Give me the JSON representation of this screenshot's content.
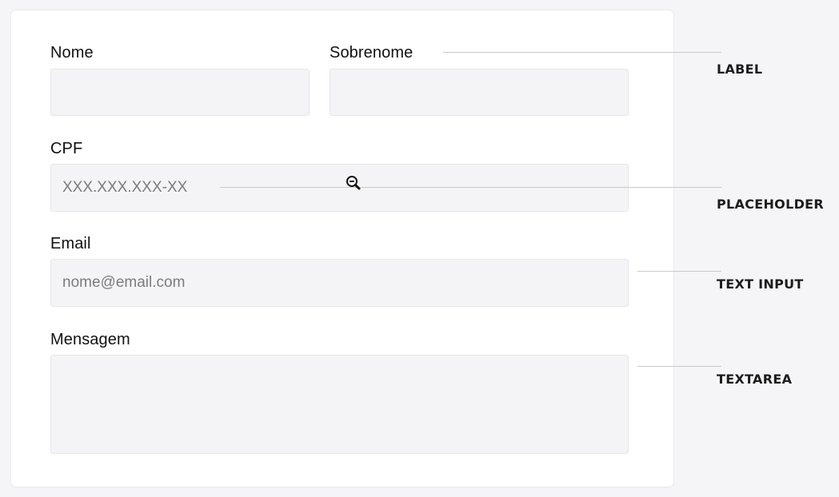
{
  "form": {
    "first_name_label": "Nome",
    "first_name_value": "",
    "last_name_label": "Sobrenome",
    "last_name_value": "",
    "cpf_label": "CPF",
    "cpf_placeholder": "XXX.XXX.XXX-XX",
    "email_label": "Email",
    "email_placeholder": "nome@email.com",
    "message_label": "Mensagem",
    "message_value": ""
  },
  "annotations": {
    "label": "LABEL",
    "placeholder": "PLACEHOLDER",
    "text_input": "TEXT INPUT",
    "textarea": "TEXTAREA"
  },
  "icons": {
    "cursor": "zoom-out-cursor-icon"
  },
  "colors": {
    "page_background": "#f5f5f7",
    "card_background": "#ffffff",
    "field_background": "#f4f4f6",
    "field_border": "#e7e7ea",
    "annotation_line": "#c9c9cc"
  }
}
